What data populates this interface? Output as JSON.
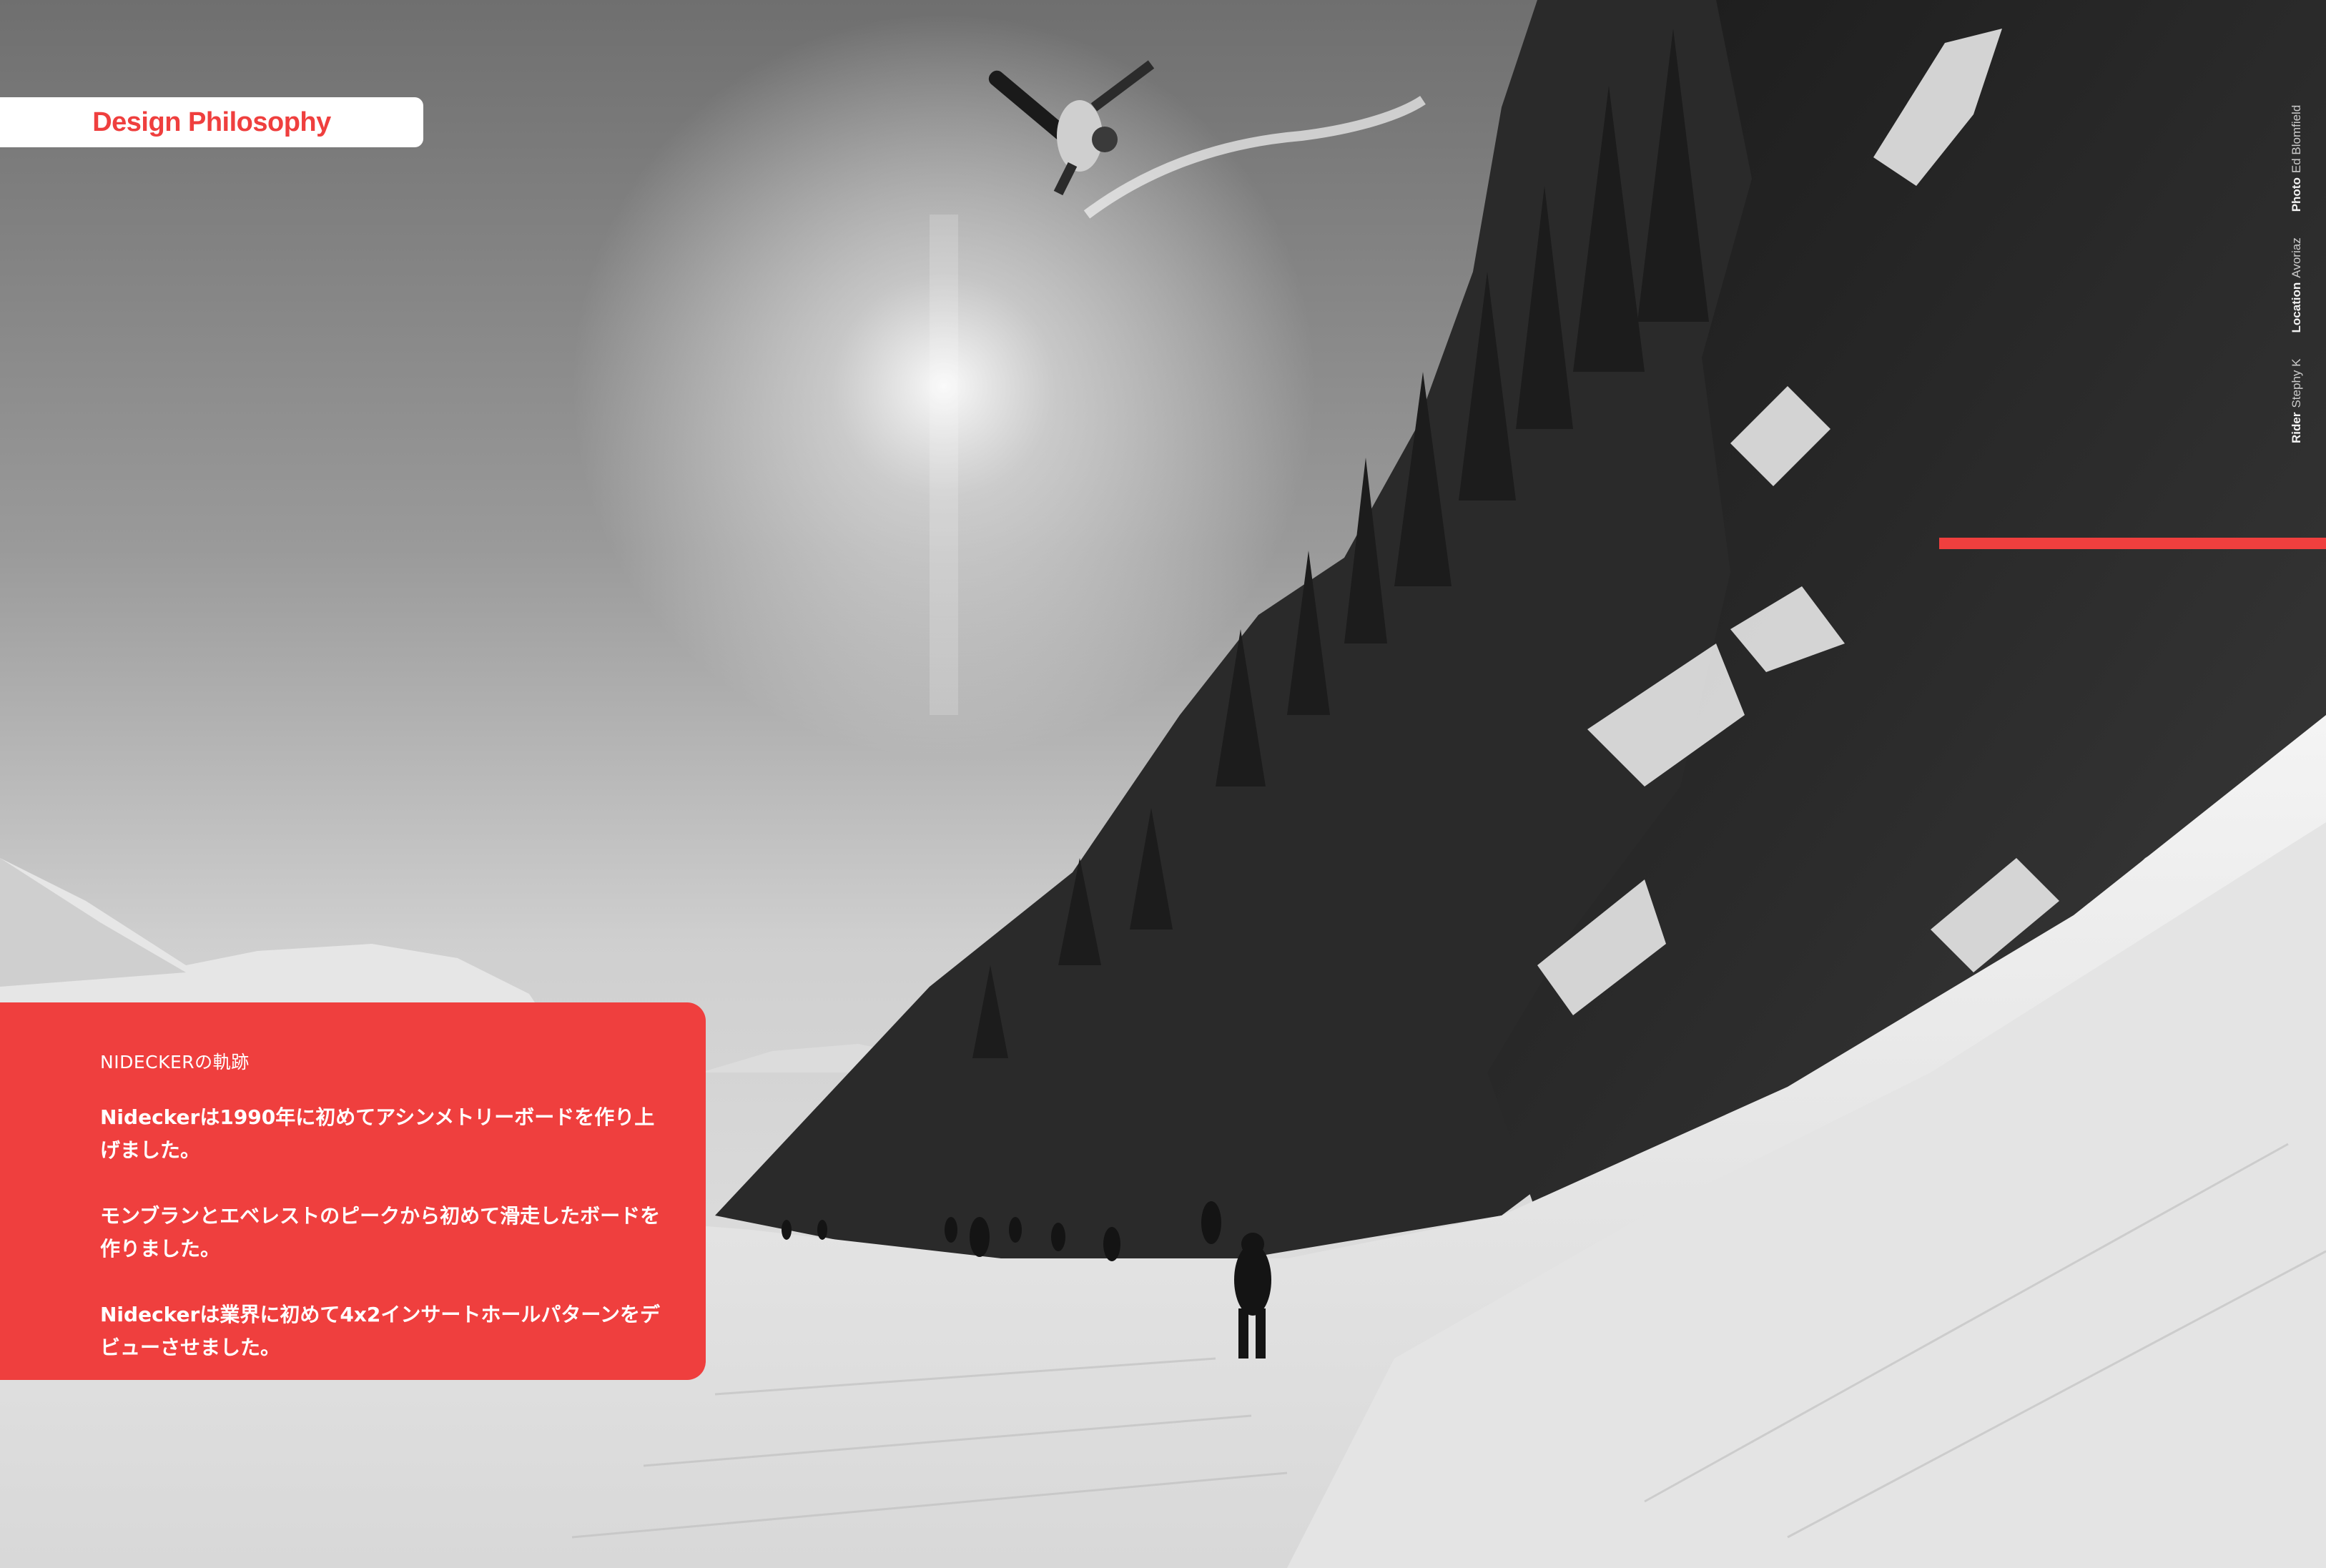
{
  "section_tab": {
    "label": "Design Philosophy"
  },
  "info_panel": {
    "kicker": "NIDECKERの軌跡",
    "items": [
      "Nideckerは1990年に初めてアシンメトリーボードを作り上げました。",
      "モンブランとエベレストのピークから初めて滑走したボードを作りました。",
      "Nideckerは業界に初めて4x2インサートホールパターンをデビューさせました。"
    ]
  },
  "credits": {
    "rider_label": "Rider",
    "rider_value": "Stephy K",
    "location_label": "Location",
    "location_value": "Avoriaz",
    "photo_label": "Photo",
    "photo_value": "Ed Blomfield"
  },
  "colors": {
    "accent": "#ef3f3e",
    "tab_background": "#ffffff",
    "panel_text": "#ffffff"
  },
  "photo": {
    "style": "black-and-white",
    "icon": "snowboard-jump-photo"
  }
}
